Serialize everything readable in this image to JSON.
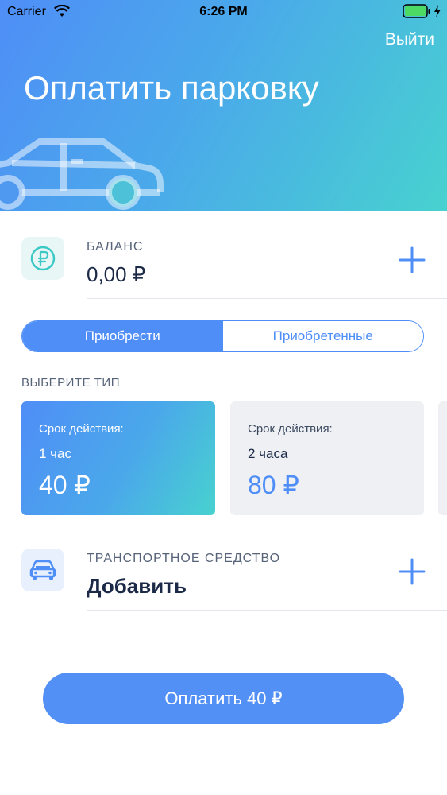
{
  "status_bar": {
    "carrier": "Carrier",
    "time": "6:26 PM"
  },
  "header": {
    "logout_label": "Выйти",
    "title": "Оплатить парковку"
  },
  "balance": {
    "label": "БАЛАНС",
    "value": "0,00 ₽"
  },
  "tabs": {
    "buy_label": "Приобрести",
    "purchased_label": "Приобретенные"
  },
  "types": {
    "section_label": "ВЫБЕРИТЕ ТИП",
    "cards": [
      {
        "validity_label": "Срок действия:",
        "duration": "1 час",
        "price": "40 ₽"
      },
      {
        "validity_label": "Срок действия:",
        "duration": "2 часа",
        "price": "80 ₽"
      }
    ]
  },
  "vehicle": {
    "label": "ТРАНСПОРТНОЕ СРЕДСТВО",
    "value": "Добавить"
  },
  "pay_button": {
    "label": "Оплатить 40 ₽"
  },
  "colors": {
    "accent": "#4f8ef7",
    "teal": "#48d2cf",
    "text_dark": "#1c2a48"
  }
}
